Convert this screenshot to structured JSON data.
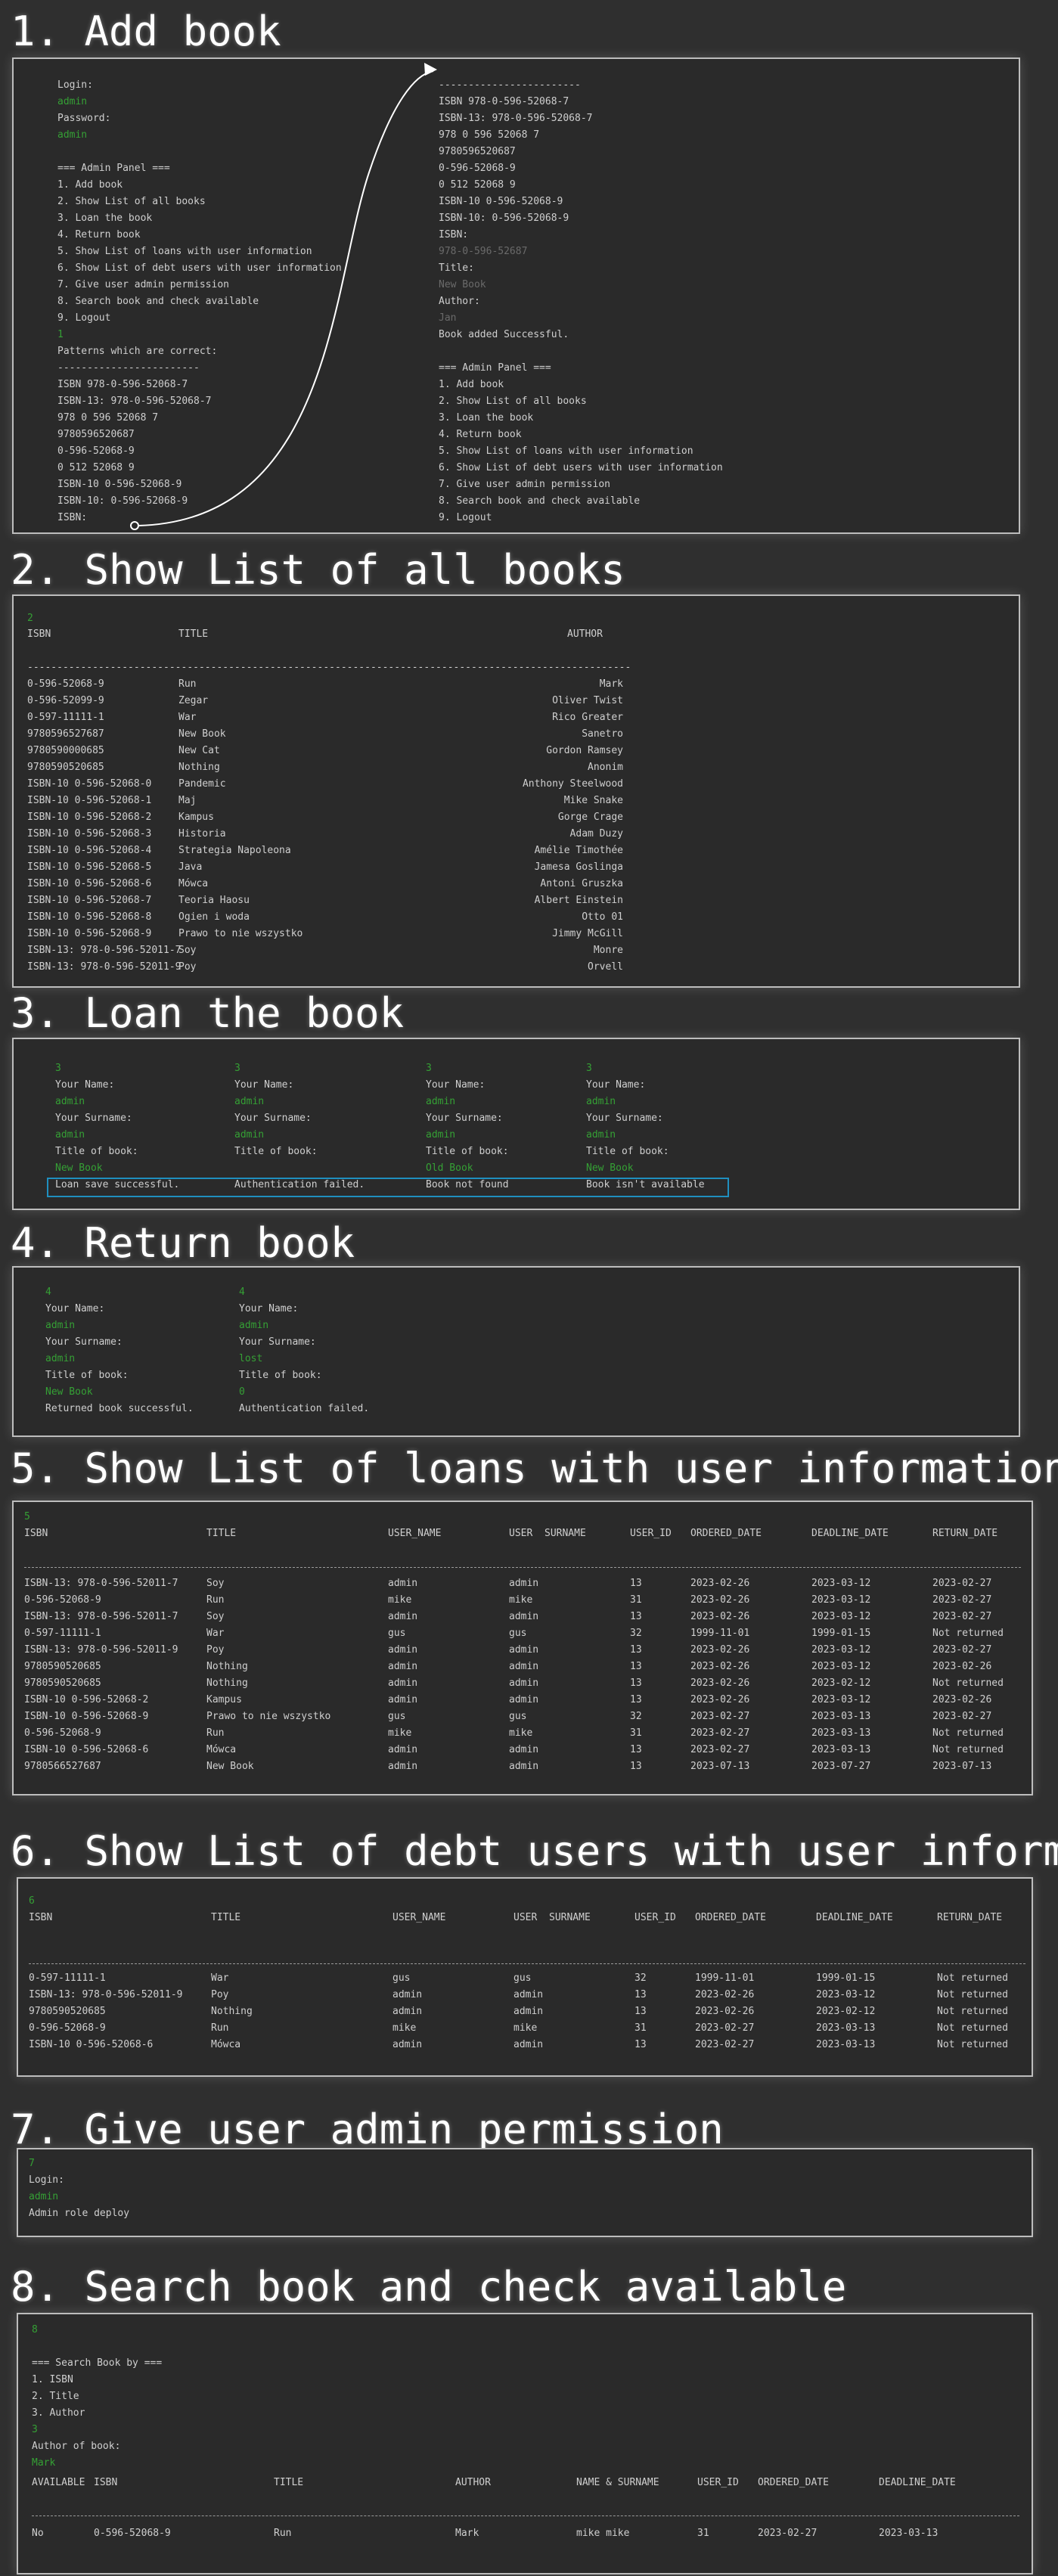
{
  "sections": {
    "s1": "1. Add book",
    "s2": "2. Show List of all books",
    "s3": "3. Loan the book",
    "s4": "4. Return book",
    "s5": "5. Show List of loans with user information",
    "s6": "6. Show List of debt users with user information",
    "s7": "7. Give user admin permission",
    "s8": "8. Search book and check available"
  },
  "menu": [
    "=== Admin Panel ===",
    "1. Add book",
    "2. Show List of all books",
    "3. Loan the book",
    "4. Return book",
    "5. Show List of loans with user information",
    "6. Show List of debt users with user information",
    "7. Give user admin permission",
    "8. Search book and check available",
    "9. Logout"
  ],
  "add_book": {
    "login_label": "Login:",
    "login_value": "admin",
    "password_label": "Password:",
    "password_value": "admin",
    "choice": "1",
    "patterns_title": "Patterns which are correct:",
    "patterns_sep": "------------------------",
    "patterns": [
      "ISBN 978-0-596-52068-7",
      "ISBN-13: 978-0-596-52068-7",
      "978 0 596 52068 7",
      "9780596520687",
      "0-596-52068-9",
      "0 512 52068 9",
      "ISBN-10 0-596-52068-9",
      "ISBN-10: 0-596-52068-9"
    ],
    "isbn_prompt": "ISBN:",
    "entered_isbn": "978-0-596-52687",
    "title_label": "Title:",
    "title_value": "New Book",
    "author_label": "Author:",
    "author_value": "Jan",
    "success": "Book added Successful."
  },
  "books": {
    "choice": "2",
    "headers": [
      "ISBN",
      "TITLE",
      "AUTHOR"
    ],
    "sep": "------------------------------------------------------------------------------------------------------",
    "rows": [
      [
        "0-596-52068-9",
        "Run",
        "Mark"
      ],
      [
        "0-596-52099-9",
        "Zegar",
        "Oliver Twist"
      ],
      [
        "0-597-11111-1",
        "War",
        "Rico Greater"
      ],
      [
        "9780596527687",
        "New Book",
        "Sanetro"
      ],
      [
        "9780590000685",
        "New Cat",
        "Gordon Ramsey"
      ],
      [
        "9780590520685",
        "Nothing",
        "Anonim"
      ],
      [
        "ISBN-10 0-596-52068-0",
        "Pandemic",
        "Anthony Steelwood"
      ],
      [
        "ISBN-10 0-596-52068-1",
        "Maj",
        "Mike Snake"
      ],
      [
        "ISBN-10 0-596-52068-2",
        "Kampus",
        "Gorge Crage"
      ],
      [
        "ISBN-10 0-596-52068-3",
        "Historia",
        "Adam Duzy"
      ],
      [
        "ISBN-10 0-596-52068-4",
        "Strategia Napoleona",
        "Amélie Timothée"
      ],
      [
        "ISBN-10 0-596-52068-5",
        "Java",
        "Jamesa Goslinga"
      ],
      [
        "ISBN-10 0-596-52068-6",
        "Mówca",
        "Antoni Gruszka"
      ],
      [
        "ISBN-10 0-596-52068-7",
        "Teoria Haosu",
        "Albert Einstein"
      ],
      [
        "ISBN-10 0-596-52068-8",
        "Ogien i woda",
        "Otto 01"
      ],
      [
        "ISBN-10 0-596-52068-9",
        "Prawo to nie wszystko",
        "Jimmy McGill"
      ],
      [
        "ISBN-13: 978-0-596-52011-7",
        "Soy",
        "Monre"
      ],
      [
        "ISBN-13: 978-0-596-52011-9",
        "Poy",
        "Orvell"
      ]
    ]
  },
  "loan": {
    "name_label": "Your Name:",
    "surname_label": "Your Surname:",
    "title_label": "Title of book:",
    "cases": [
      {
        "choice": "3",
        "name": "admin",
        "surname": "admin",
        "title": "New Book",
        "result": "Loan save successful."
      },
      {
        "choice": "3",
        "name": "admin",
        "surname": "admin",
        "title": "",
        "result": "Authentication failed."
      },
      {
        "choice": "3",
        "name": "admin",
        "surname": "admin",
        "title": "Old Book",
        "result": "Book not found"
      },
      {
        "choice": "3",
        "name": "admin",
        "surname": "admin",
        "title": "New Book",
        "result": "Book isn't available"
      }
    ]
  },
  "return_book": {
    "name_label": "Your Name:",
    "surname_label": "Your Surname:",
    "title_label": "Title of book:",
    "cases": [
      {
        "choice": "4",
        "name": "admin",
        "surname": "admin",
        "title": "New Book",
        "result": "Returned book successful."
      },
      {
        "choice": "4",
        "name": "admin",
        "surname": "lost",
        "title": "0",
        "result": "Authentication failed."
      }
    ]
  },
  "loans": {
    "choice": "5",
    "headers": [
      "ISBN",
      "TITLE",
      "USER_NAME",
      "USER",
      "SURNAME",
      "USER_ID",
      "ORDERED_DATE",
      "DEADLINE_DATE",
      "RETURN_DATE"
    ],
    "sep": "--------------------------------------------------------------------------------------------------------------------------------------------",
    "rows": [
      [
        "ISBN-13: 978-0-596-52011-7",
        "Soy",
        "admin",
        "admin",
        "13",
        "2023-02-26",
        "2023-03-12",
        "2023-02-27"
      ],
      [
        "0-596-52068-9",
        "Run",
        "mike",
        "mike",
        "31",
        "2023-02-26",
        "2023-03-12",
        "2023-02-27"
      ],
      [
        "ISBN-13: 978-0-596-52011-7",
        "Soy",
        "admin",
        "admin",
        "13",
        "2023-02-26",
        "2023-03-12",
        "2023-02-27"
      ],
      [
        "0-597-11111-1",
        "War",
        "gus",
        "gus",
        "32",
        "1999-11-01",
        "1999-01-15",
        "Not returned"
      ],
      [
        "ISBN-13: 978-0-596-52011-9",
        "Poy",
        "admin",
        "admin",
        "13",
        "2023-02-26",
        "2023-03-12",
        "2023-02-27"
      ],
      [
        "9780590520685",
        "Nothing",
        "admin",
        "admin",
        "13",
        "2023-02-26",
        "2023-03-12",
        "2023-02-26"
      ],
      [
        "9780590520685",
        "Nothing",
        "admin",
        "admin",
        "13",
        "2023-02-26",
        "2023-02-12",
        "Not returned"
      ],
      [
        "ISBN-10 0-596-52068-2",
        "Kampus",
        "admin",
        "admin",
        "13",
        "2023-02-26",
        "2023-03-12",
        "2023-02-26"
      ],
      [
        "ISBN-10 0-596-52068-9",
        "Prawo to nie wszystko",
        "gus",
        "gus",
        "32",
        "2023-02-27",
        "2023-03-13",
        "2023-02-27"
      ],
      [
        "0-596-52068-9",
        "Run",
        "mike",
        "mike",
        "31",
        "2023-02-27",
        "2023-03-13",
        "Not returned"
      ],
      [
        "ISBN-10 0-596-52068-6",
        "Mówca",
        "admin",
        "admin",
        "13",
        "2023-02-27",
        "2023-03-13",
        "Not returned"
      ],
      [
        "9780566527687",
        "New Book",
        "admin",
        "admin",
        "13",
        "2023-07-13",
        "2023-07-27",
        "2023-07-13"
      ]
    ]
  },
  "debts": {
    "choice": "6",
    "rows": [
      [
        "0-597-11111-1",
        "War",
        "gus",
        "gus",
        "32",
        "1999-11-01",
        "1999-01-15",
        "Not returned"
      ],
      [
        "ISBN-13: 978-0-596-52011-9",
        "Poy",
        "admin",
        "admin",
        "13",
        "2023-02-26",
        "2023-03-12",
        "Not returned"
      ],
      [
        "9780590520685",
        "Nothing",
        "admin",
        "admin",
        "13",
        "2023-02-26",
        "2023-02-12",
        "Not returned"
      ],
      [
        "0-596-52068-9",
        "Run",
        "mike",
        "mike",
        "31",
        "2023-02-27",
        "2023-03-13",
        "Not returned"
      ],
      [
        "ISBN-10 0-596-52068-6",
        "Mówca",
        "admin",
        "admin",
        "13",
        "2023-02-27",
        "2023-03-13",
        "Not returned"
      ]
    ]
  },
  "permission": {
    "choice": "7",
    "login_label": "Login:",
    "login_value": "admin",
    "result": "Admin role deploy"
  },
  "search": {
    "choice": "8",
    "menu_title": "=== Search Book by ===",
    "options": [
      "1. ISBN",
      "2. Title",
      "3. Author"
    ],
    "option_choice": "3",
    "author_label": "Author of book:",
    "author_value": "Mark",
    "headers": [
      "AVAILABLE",
      "ISBN",
      "TITLE",
      "AUTHOR",
      "NAME & SURNAME",
      "USER_ID",
      "ORDERED_DATE",
      "DEADLINE_DATE"
    ],
    "sep": "-------------------------------------------------------------------------------------------------------------------------------------------",
    "row": [
      "No",
      "0-596-52068-9",
      "Run",
      "Mark",
      "mike mike",
      "31",
      "2023-02-27",
      "2023-03-13"
    ]
  },
  "colors": {
    "background": "#2f2f2f",
    "input_green": "#35a035",
    "highlight": "#1f8fbf",
    "text": "#cfcfcf"
  }
}
